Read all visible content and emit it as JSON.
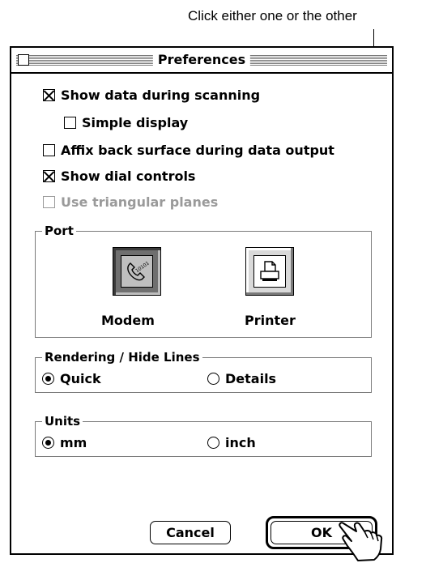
{
  "annotation": {
    "text": "Click either one or the other"
  },
  "window": {
    "title": "Preferences"
  },
  "options": {
    "show_data": {
      "label": "Show data during scanning",
      "checked": true
    },
    "simple_display": {
      "label": "Simple display",
      "checked": false
    },
    "affix_back": {
      "label": "Affix back surface during data output",
      "checked": false
    },
    "dial_controls": {
      "label": "Show dial controls",
      "checked": true
    },
    "triangular": {
      "label": "Use triangular planes",
      "checked": false,
      "enabled": false
    }
  },
  "port": {
    "label": "Port",
    "items": [
      {
        "label": "Modem",
        "icon": "modem-icon",
        "selected": true
      },
      {
        "label": "Printer",
        "icon": "printer-icon",
        "selected": false
      }
    ]
  },
  "rendering": {
    "label": "Rendering / Hide Lines",
    "options": [
      {
        "label": "Quick",
        "selected": true
      },
      {
        "label": "Details",
        "selected": false
      }
    ]
  },
  "units": {
    "label": "Units",
    "options": [
      {
        "label": "mm",
        "selected": true
      },
      {
        "label": "inch",
        "selected": false
      }
    ]
  },
  "buttons": {
    "cancel": "Cancel",
    "ok": "OK"
  }
}
